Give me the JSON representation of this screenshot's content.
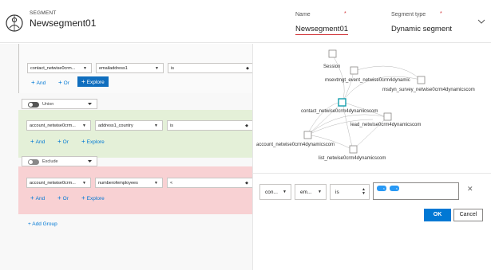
{
  "header": {
    "kicker": "SEGMENT",
    "title": "Newsegment01",
    "name_label": "Name",
    "name_value": "Newsegment01",
    "type_label": "Segment type",
    "type_value": "Dynamic segment",
    "required_marker": "*"
  },
  "builder": {
    "group1": {
      "row": {
        "entity": "contact_netwise0crm...",
        "attribute": "emailaddress1",
        "operator": "is"
      },
      "and_label": "And",
      "or_label": "Or",
      "explore_label": "Explore"
    },
    "union_label": "Union",
    "group2": {
      "row": {
        "entity": "account_netwise0crm...",
        "attribute": "address1_country",
        "operator": "is"
      },
      "and_label": "And",
      "or_label": "Or",
      "explore_label": "Explore"
    },
    "exclude_label": "Exclude",
    "group3": {
      "row": {
        "entity": "account_netwise0crm...",
        "attribute": "numberofemployees",
        "operator": "<"
      },
      "and_label": "And",
      "or_label": "Or",
      "explore_label": "Explore"
    },
    "add_group_label": "Add Group"
  },
  "explorer": {
    "graph_labels": {
      "session": "Session",
      "msevtmgt": "msevtmgt_event_netwise0crm4dynamic",
      "msdyn": "msdyn_survey_netwise0crm4dynamicscom",
      "contact": "contact_netwise0crm4dynamicscom",
      "lead": "lead_netwise0crm4dynamicscom",
      "account": "account_netwise0crm4dynamicscom",
      "list": "list_netwise0crm4dynamicscom"
    },
    "condition": {
      "entity": "con...",
      "attribute": "em...",
      "operator": "is",
      "tag1": "×",
      "tag2": "×"
    },
    "ok_label": "OK",
    "cancel_label": "Cancel"
  },
  "colors": {
    "accent": "#0078d4",
    "union_group_bg": "#e4f0d8",
    "exclude_group_bg": "#f8d1d3",
    "required": "#d13438",
    "focus_node": "#0097a7"
  }
}
